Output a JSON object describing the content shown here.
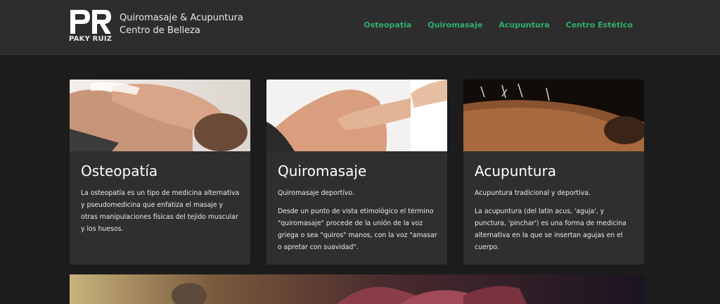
{
  "header": {
    "logo_text": "PAKY RUIZ",
    "brand_line1": "Quiromasaje & Acupuntura",
    "brand_line2": "Centro de Belleza"
  },
  "nav": {
    "items": [
      {
        "label": "Osteopatía"
      },
      {
        "label": "Quiromasaje"
      },
      {
        "label": "Acupuntura"
      },
      {
        "label": "Centro Estético"
      }
    ]
  },
  "cards": [
    {
      "title": "Osteopatía",
      "paragraphs": [
        "La osteopatía es un tipo de medicina alternativa y pseudomedicina que enfatiza el masaje y otras manipulaciones físicas del tejido muscular y los huesos."
      ]
    },
    {
      "title": "Quiromasaje",
      "paragraphs": [
        "Quiromasaje deportivo.",
        "Desde un punto de vista etimológico el término \"quiromasaje\" procede de la unión de la voz griega o sea \"quiros\" manos, con la voz \"amasar o apretar con suavidad\"."
      ]
    },
    {
      "title": "Acupuntura",
      "paragraphs": [
        "Acupuntura tradicional y deportiva.",
        "La acupuntura (del latín acus, 'aguja', y punctura, 'pinchar') es una forma de medicina alternativa en la que se insertan agujas en el cuerpo."
      ]
    }
  ],
  "colors": {
    "accent": "#2fb06a",
    "header_bg": "#2d2d2d",
    "page_bg": "#1c1c1c",
    "card_bg": "#2f2f2f"
  }
}
